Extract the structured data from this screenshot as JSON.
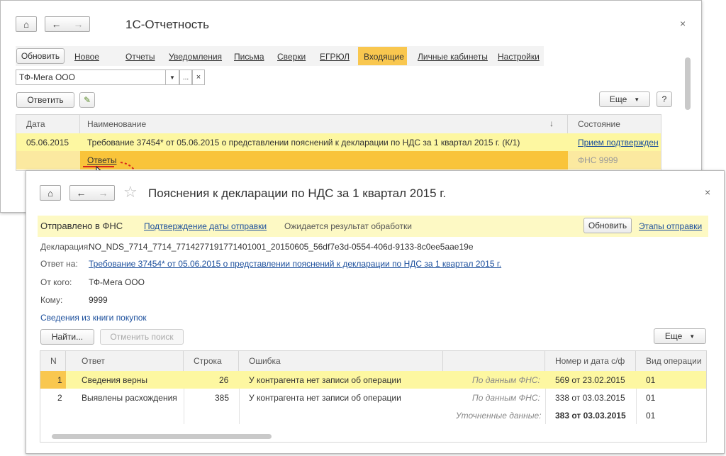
{
  "back_window": {
    "title": "1С-Отчетность",
    "refresh_label": "Обновить",
    "new_label": "Новое",
    "nav": [
      "Отчеты",
      "Уведомления",
      "Письма",
      "Сверки",
      "ЕГРЮЛ",
      "Входящие",
      "Личные кабинеты",
      "Настройки"
    ],
    "org_value": "ТФ-Мега ООО",
    "ellipsis": "...",
    "reply_label": "Ответить",
    "more_label": "Еще",
    "help_label": "?",
    "columns": {
      "date": "Дата",
      "name": "Наименование",
      "state": "Состояние"
    },
    "row": {
      "date": "05.06.2015",
      "name": "Требование 37454* от 05.06.2015 о представлении пояснений к декларации по НДС за 1 квартал 2015 г. (К/1)",
      "state": "Прием подтвержден"
    },
    "subrow": {
      "name": "Ответы",
      "state": "ФНС 9999"
    }
  },
  "front_window": {
    "title": "Пояснения к декларации по НДС за 1 квартал 2015 г.",
    "status": "Отправлено в ФНС",
    "confirm_link": "Подтверждение даты отправки",
    "awaiting": "Ожидается результат обработки",
    "refresh_label": "Обновить",
    "stages_link": "Этапы отправки",
    "declaration_label": "Декларация:",
    "declaration_value": "NO_NDS_7714_7714_7714277191771401001_20150605_56df7e3d-0554-406d-9133-8c0ee5aae19e",
    "reply_to_label": "Ответ на:",
    "reply_to_value": "Требование 37454* от 05.06.2015 о представлении пояснений к декларации по НДС за 1 квартал 2015 г.",
    "from_label": "От кого:",
    "from_value": "ТФ-Мега ООО",
    "to_label": "Кому:",
    "to_value": "9999",
    "book_link": "Сведения из книги покупок",
    "find_label": "Найти...",
    "cancel_search_label": "Отменить поиск",
    "more_label": "Еще",
    "columns": {
      "n": "N",
      "answer": "Ответ",
      "line": "Строка",
      "error": "Ошибка",
      "number_date": "Номер и дата с/ф",
      "op_type": "Вид операции"
    },
    "rows": [
      {
        "n": "1",
        "answer": "Сведения верны",
        "line": "26",
        "error": "У контрагента нет записи об операции",
        "source": "По данным ФНС:",
        "number_date": "569 от 23.02.2015",
        "op_type": "01"
      },
      {
        "n": "2",
        "answer": "Выявлены расхождения",
        "line": "385",
        "error": "У контрагента нет записи об операции",
        "source": "По данным ФНС:",
        "number_date": "338 от 03.03.2015",
        "op_type": "01"
      }
    ],
    "refined": {
      "source": "Уточненные данные:",
      "number_date": "383 от 03.03.2015",
      "op_type": "01"
    }
  },
  "colors": {
    "selected_row": "#fdf7a1",
    "accent_orange": "#f9c74f",
    "subrow_orange": "#f9c43a",
    "status_bar": "#fdf9c4",
    "link": "#1c4f9c",
    "arrow_red": "#d9261c"
  }
}
